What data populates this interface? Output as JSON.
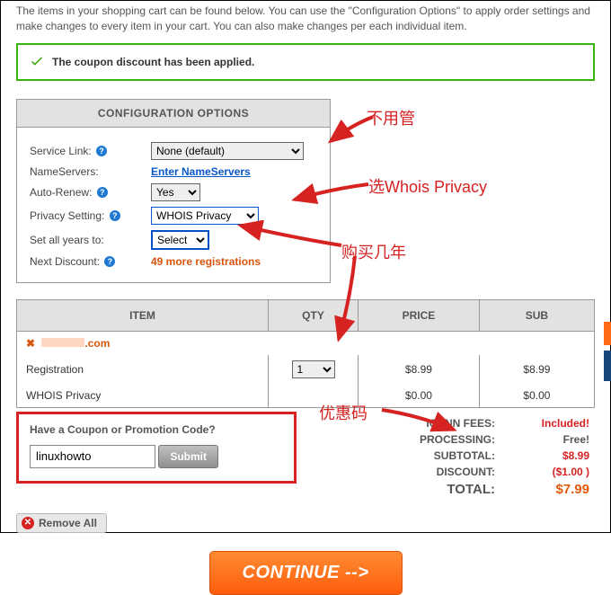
{
  "intro": "The items in your shopping cart can be found below. You can use the \"Configuration Options\" to apply order settings and make changes to every item in your cart. You can also make changes per each individual item.",
  "banner": {
    "text": "The coupon discount has been applied."
  },
  "config": {
    "header": "CONFIGURATION OPTIONS",
    "service_link_label": "Service Link:",
    "service_link_value": "None (default)",
    "nameservers_label": "NameServers:",
    "nameservers_link": "Enter NameServers",
    "auto_renew_label": "Auto-Renew:",
    "auto_renew_value": "Yes",
    "privacy_label": "Privacy Setting:",
    "privacy_value": "WHOIS Privacy",
    "years_label": "Set all years to:",
    "years_value": "Select",
    "next_discount_label": "Next Discount:",
    "next_discount_value": "49 more registrations"
  },
  "table": {
    "headers": {
      "item": "ITEM",
      "qty": "QTY",
      "price": "PRICE",
      "sub": "SUB"
    },
    "domain_suffix": ".com",
    "rows": [
      {
        "item": "Registration",
        "qty": "1",
        "price": "$8.99",
        "sub": "$8.99"
      },
      {
        "item": "WHOIS Privacy",
        "qty": "",
        "price": "$0.00",
        "sub": "$0.00"
      }
    ]
  },
  "coupon": {
    "label": "Have a Coupon or Promotion Code?",
    "value": "linuxhowto",
    "submit": "Submit"
  },
  "summary": {
    "icann_fees_label": "ICANN FEES:",
    "icann_fees_value": "Included!",
    "processing_label": "PROCESSING:",
    "processing_value": "Free!",
    "subtotal_label": "SUBTOTAL:",
    "subtotal_value": "$8.99",
    "discount_label": "DISCOUNT:",
    "discount_value": "($1.00 )",
    "total_label": "TOTAL:",
    "total_value": "$7.99"
  },
  "remove_all": "Remove All",
  "continue_label": "CONTINUE -->",
  "annotations": {
    "a1": "不用管",
    "a2": "选Whois Privacy",
    "a3": "购买几年",
    "a4": "优惠码"
  }
}
